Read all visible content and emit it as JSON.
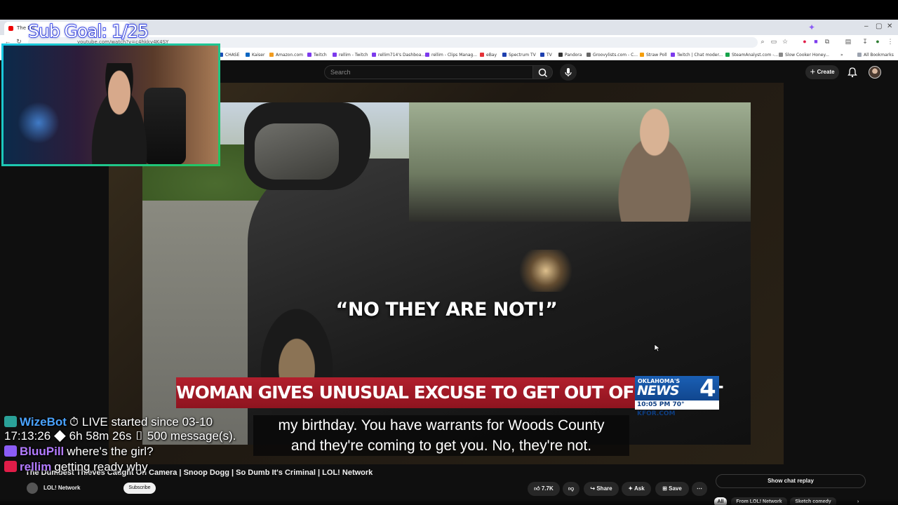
{
  "browser": {
    "tab_title": "The Du",
    "url": "youtube.com/watch?v=c4hkkv4K4SY",
    "bookmarks": [
      "CHASE",
      "Kaiser",
      "Amazon.com",
      "Twitch",
      "rellim - Twitch",
      "rellim714's Dashboa...",
      "rellim - Clips Manag...",
      "eBay",
      "Spectrum TV",
      "TV",
      "Pandora",
      "Groovylists.com - C...",
      "Straw Poll",
      "Twitch | Chat moder...",
      "SteamAnalyst.com -...",
      "Slow Cooker Honey..."
    ],
    "all_bookmarks": "All Bookmarks"
  },
  "youtube": {
    "search_placeholder": "Search",
    "create_label": "Create"
  },
  "video": {
    "quote": "“NO THEY ARE NOT!”",
    "banner": "WOMAN GIVES UNUSUAL EXCUSE TO GET OUT OF A TICKET",
    "news_state": "OKLAHOMA'S",
    "news_name": "NEWS",
    "news_number": "4",
    "news_time": "10:05 PM  70° KFOR.COM",
    "caption_line1": "my birthday. You have warrants for Woods County",
    "caption_line2": "and they're coming to get you. No, they're not."
  },
  "overlay": {
    "sub_goal": "Sub Goal: 1/25"
  },
  "chat": [
    {
      "user": "WizeBot",
      "color": "#4aa3ff",
      "badge_color": "#2aa198",
      "message": "⏱ LIVE started since 03-10 17:13:26 ◆ 6h 58m 26s ▯ 500 message(s)."
    },
    {
      "user": "BluuPill",
      "color": "#b37bff",
      "badge_color": "#8b5cf6",
      "message": "where's the girl?"
    },
    {
      "user": "rellim",
      "color": "#b37bff",
      "badge_color": "#e11d48",
      "message": "getting ready why"
    }
  ],
  "below_video": {
    "title": "The Dumbest Thieves Caught On Camera | Snoop Dogg | So Dumb It's Criminal | LOL! Network",
    "channel": "LOL! Network",
    "subscribe": "Subscribe",
    "likes": "7.7K",
    "share": "Share",
    "ask": "Ask",
    "save": "Save",
    "show_chat_replay": "Show chat replay",
    "chips": [
      "All",
      "From LOL! Network",
      "Sketch comedy"
    ]
  }
}
